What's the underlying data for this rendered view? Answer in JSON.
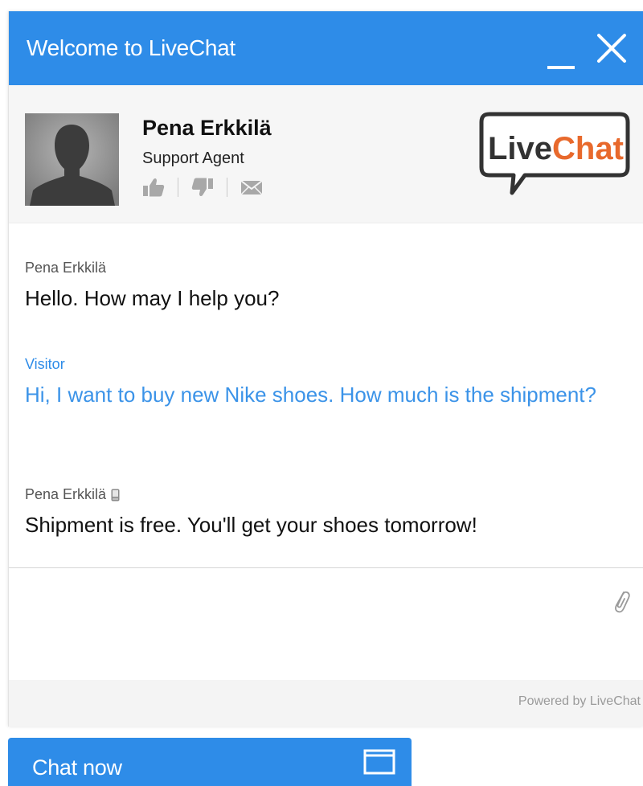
{
  "header": {
    "title": "Welcome to LiveChat"
  },
  "agent": {
    "name": "Pena Erkkilä",
    "role": "Support Agent",
    "actions": [
      "thumbs-up-icon",
      "thumbs-down-icon",
      "envelope-icon"
    ]
  },
  "logo": {
    "part1": "Live",
    "part2": "Chat",
    "part1_color": "#333333",
    "part2_color": "#e8692c"
  },
  "messages": [
    {
      "author": "Pena Erkkilä",
      "text": "Hello. How may I help you?",
      "type": "agent"
    },
    {
      "author": "Visitor",
      "text": "Hi, I want to buy new Nike shoes. How much is the shipment?",
      "type": "visitor"
    },
    {
      "author": "Pena Erkkilä",
      "text": "Shipment is free. You'll get your shoes tomorrow!",
      "type": "agent",
      "mobile_icon": "mobile-phone-icon"
    }
  ],
  "input": {
    "placeholder": "",
    "attach_icon": "paperclip-icon"
  },
  "footer": {
    "powered_by": "Powered by LiveChat"
  },
  "chat_button": {
    "label": "Chat now",
    "icon": "window-icon"
  },
  "colors": {
    "accent": "#2e8ce8",
    "visitor_text": "#3b93e8"
  }
}
